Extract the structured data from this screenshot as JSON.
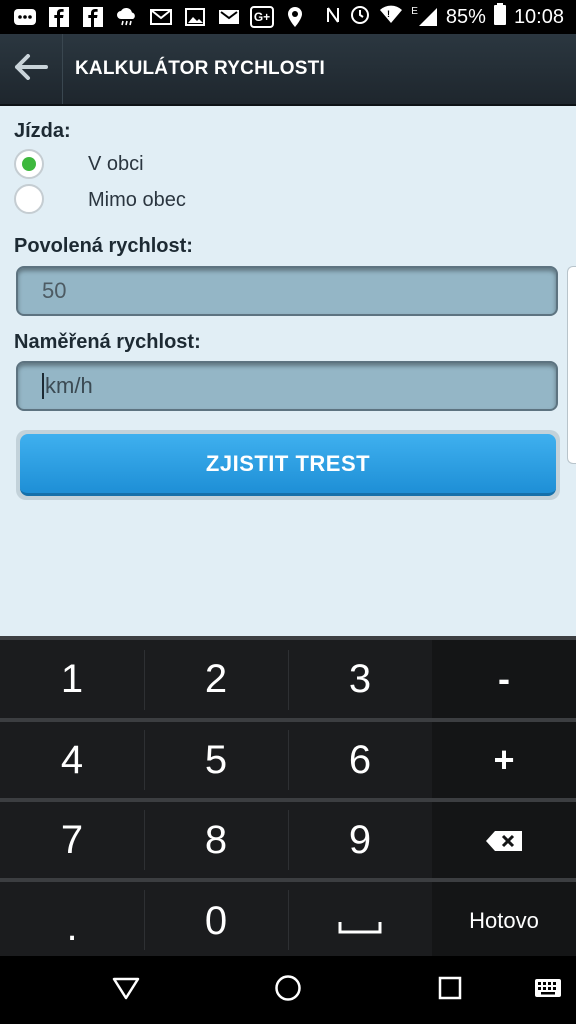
{
  "status_bar": {
    "icons": [
      "bbm-icon",
      "facebook-icon",
      "facebook-icon",
      "weather-icon",
      "email-icon",
      "image-icon",
      "gmail-icon",
      "google-plus-icon",
      "location-icon",
      "nfc-icon",
      "alarm-icon",
      "wifi-icon",
      "signal-icon",
      "battery-icon"
    ],
    "gplus_text": "G+",
    "signal_label": "E",
    "battery": "85%",
    "time": "10:08"
  },
  "app_bar": {
    "title": "KALKULÁTOR RYCHLOSTI"
  },
  "form": {
    "ride_label": "Jízda:",
    "ride_options": [
      {
        "label": "V obci",
        "selected": true
      },
      {
        "label": "Mimo obec",
        "selected": false
      }
    ],
    "allowed_speed_label": "Povolená rychlost:",
    "allowed_speed_value": "50",
    "measured_speed_label": "Naměřená rychlost:",
    "measured_speed_placeholder": "km/h",
    "submit_label": "ZJISTIT TREST"
  },
  "keyboard": {
    "rows": [
      [
        "1",
        "2",
        "3",
        "-"
      ],
      [
        "4",
        "5",
        "6",
        "+"
      ],
      [
        "7",
        "8",
        "9",
        "⌫"
      ],
      [
        ".",
        "0",
        "␣",
        "Hotovo"
      ]
    ]
  },
  "colors": {
    "accent": "#2b9fe6",
    "radio_selected": "#3db83d",
    "background": "#e1eef5",
    "field": "#94b6c6"
  }
}
